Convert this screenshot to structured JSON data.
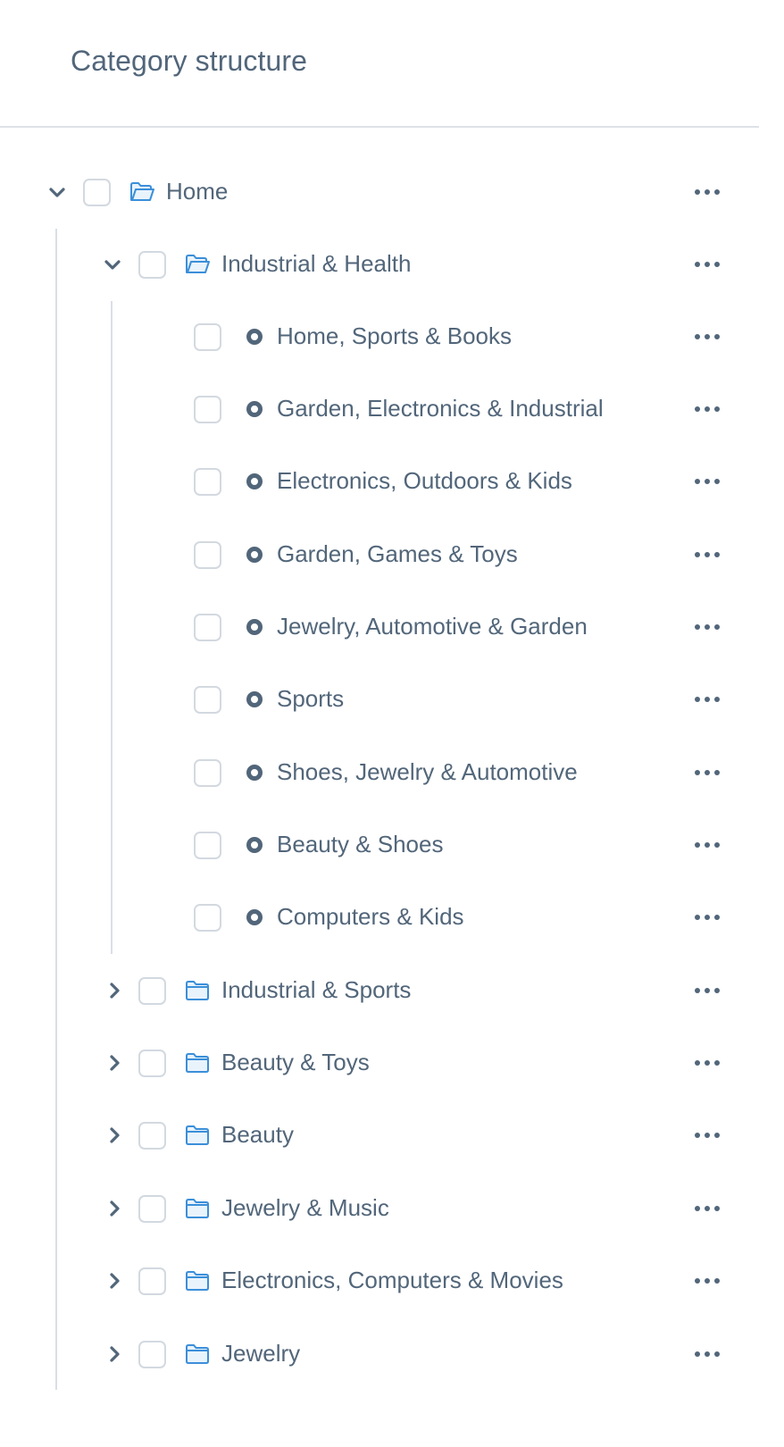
{
  "header": {
    "title": "Category structure"
  },
  "tree": {
    "root": {
      "label": "Home",
      "expanded": true
    },
    "level1_expanded": {
      "label": "Industrial & Health",
      "expanded": true
    },
    "leaves": [
      "Home, Sports & Books",
      "Garden, Electronics & Industrial",
      "Electronics, Outdoors & Kids",
      "Garden, Games & Toys",
      "Jewelry, Automotive & Garden",
      "Sports",
      "Shoes, Jewelry & Automotive",
      "Beauty & Shoes",
      "Computers & Kids"
    ],
    "collapsed_folders": [
      "Industrial & Sports",
      "Beauty & Toys",
      "Beauty",
      "Jewelry & Music",
      "Electronics, Computers & Movies",
      "Jewelry"
    ]
  },
  "colors": {
    "text": "#52667a",
    "folder": "#3b8fd9",
    "border": "#d3d9e0",
    "divider": "#dde2e8"
  },
  "icons": {
    "expanded": "chevron-down-icon",
    "collapsed": "chevron-right-icon",
    "folder": "folder-icon",
    "open_folder": "folder-open-icon",
    "leaf": "circle-bullet-icon",
    "menu": "more-horizontal-icon"
  }
}
